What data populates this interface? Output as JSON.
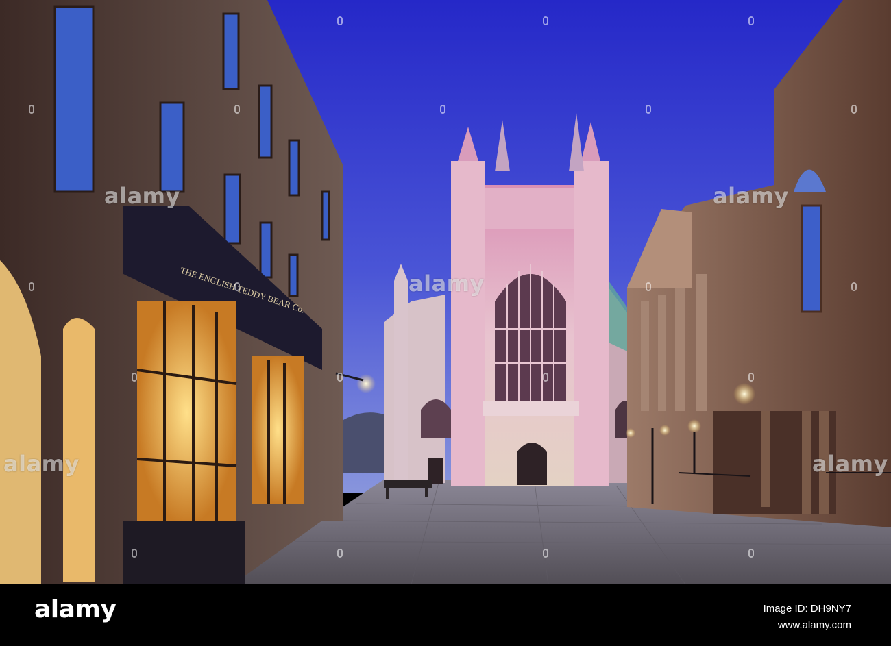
{
  "shop_sign": "THE ENGLISH TEDDY BEAR Co.",
  "watermarks": {
    "text": "alamy"
  },
  "footer": {
    "brand": "alamy",
    "image_id_label": "Image ID: DH9NY7",
    "url": "www.alamy.com"
  },
  "colors": {
    "sky_top": "#2a2fd0",
    "sky_bottom": "#6a7ad8",
    "stone_lit": "#e9cdd8",
    "window_glow": "#f3c15a",
    "pavement": "#6f6a72",
    "watermark": "#ffffff"
  }
}
